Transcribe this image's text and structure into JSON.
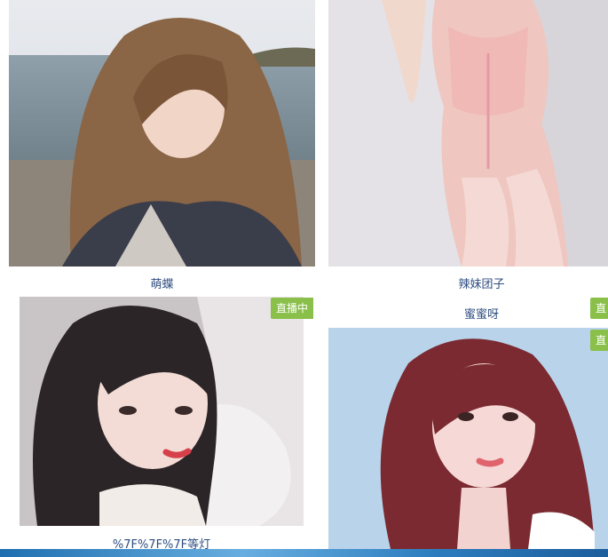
{
  "cards": [
    {
      "name": "萌蝶",
      "badge": ""
    },
    {
      "name": "辣妹团子",
      "badge": ""
    },
    {
      "name": "%7F%7F%7F等灯",
      "badge": "直播中"
    },
    {
      "name": "蜜蜜呀",
      "badge": "直"
    },
    {
      "name": "",
      "badge": "直"
    }
  ],
  "colors": {
    "badge_bg": "#8ac04a",
    "name_text": "#2f4e80",
    "bottom_bar": "#2e7fc0"
  }
}
